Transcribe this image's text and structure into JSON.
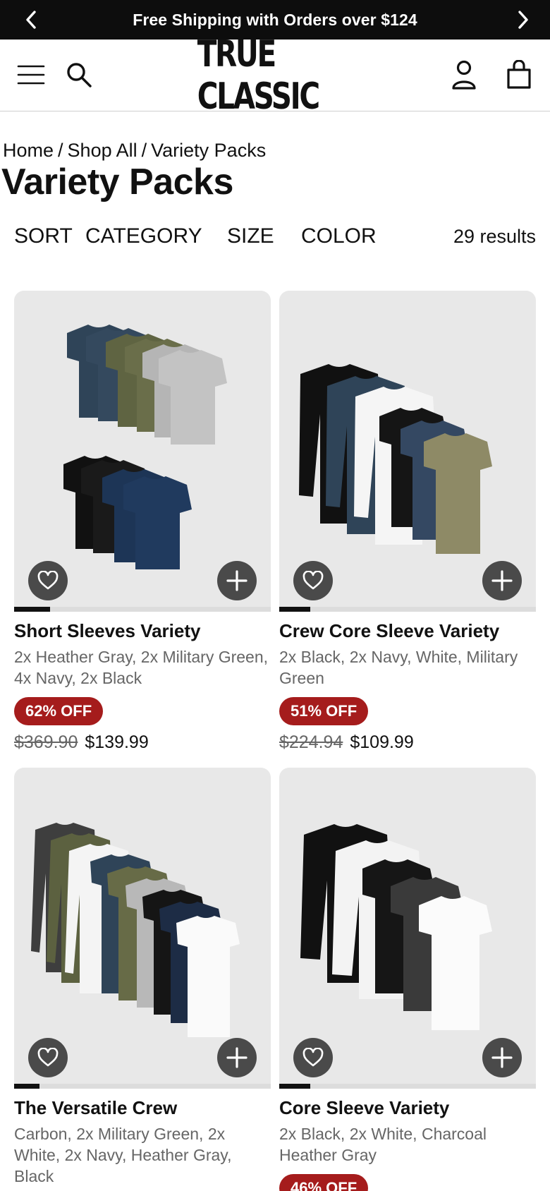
{
  "announcement": {
    "text": "Free Shipping with Orders over $124",
    "prev_icon": "chevron-left-icon",
    "next_icon": "chevron-right-icon"
  },
  "header": {
    "logo": "TRUE CLASSIC",
    "menu_icon": "hamburger-menu-icon",
    "search_icon": "search-icon",
    "account_icon": "account-icon",
    "bag_icon": "shopping-bag-icon"
  },
  "breadcrumb": {
    "items": [
      "Home",
      "Shop All",
      "Variety Packs"
    ],
    "separator": "/"
  },
  "page_title": "Variety Packs",
  "filters": {
    "sort": "SORT",
    "category": "CATEGORY",
    "size": "SIZE",
    "color": "COLOR",
    "results": "29 results"
  },
  "colors": {
    "badge": "#a51c1c",
    "announcement_bg": "#0d0d0d",
    "card_bg": "#e8e8e8",
    "button_bg": "#4a4a4a"
  },
  "products": [
    {
      "name": "Short Sleeves Variety",
      "description": "2x Heather Gray, 2x Military Green, 4x Navy, 2x Black",
      "discount": "62% OFF",
      "original_price": "$369.90",
      "sale_price": "$139.99",
      "carousel_progress": 0.14
    },
    {
      "name": "Crew Core Sleeve Variety",
      "description": "2x Black, 2x Navy, White, Military Green",
      "discount": "51% OFF",
      "original_price": "$224.94",
      "sale_price": "$109.99",
      "carousel_progress": 0.12
    },
    {
      "name": "The Versatile Crew",
      "description": "Carbon, 2x Military Green, 2x White, 2x Navy, Heather Gray, Black",
      "discount": "",
      "original_price": "",
      "sale_price": "",
      "carousel_progress": 0.1
    },
    {
      "name": "Core Sleeve Variety",
      "description": "2x Black, 2x White, Charcoal Heather Gray",
      "discount": "46% OFF",
      "original_price": "",
      "sale_price": "",
      "carousel_progress": 0.12
    }
  ]
}
